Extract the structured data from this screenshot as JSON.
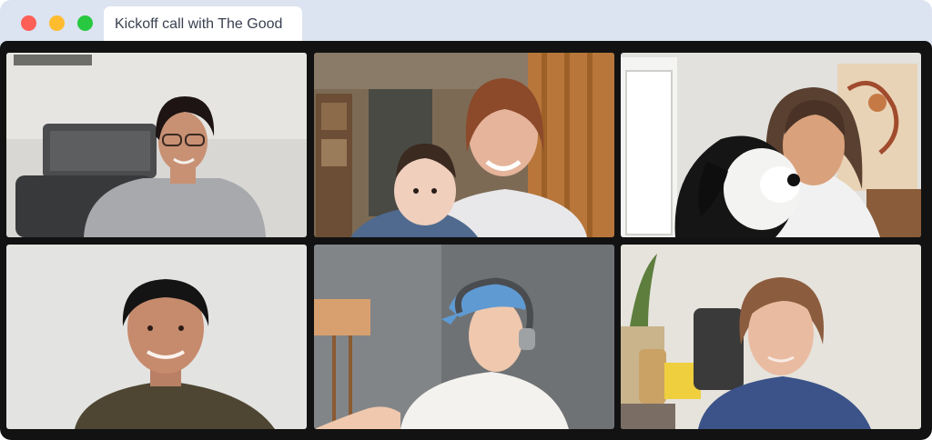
{
  "window": {
    "title": "Kickoff call with The Good",
    "controls": [
      {
        "name": "close",
        "color": "#fe5f57"
      },
      {
        "name": "minimize",
        "color": "#febc2e"
      },
      {
        "name": "zoom",
        "color": "#28c840"
      }
    ],
    "chrome_color": "#dce3f1",
    "grid_background": "#121212"
  },
  "participants": [
    {
      "tile": 1,
      "description": "woman with glasses and grey fleece"
    },
    {
      "tile": 2,
      "description": "woman holding baby"
    },
    {
      "tile": 3,
      "description": "woman with black-and-white dog"
    },
    {
      "tile": 4,
      "description": "man in olive sweater"
    },
    {
      "tile": 5,
      "description": "woman with blue cap and headphones"
    },
    {
      "tile": 6,
      "description": "woman in navy sweater"
    }
  ]
}
